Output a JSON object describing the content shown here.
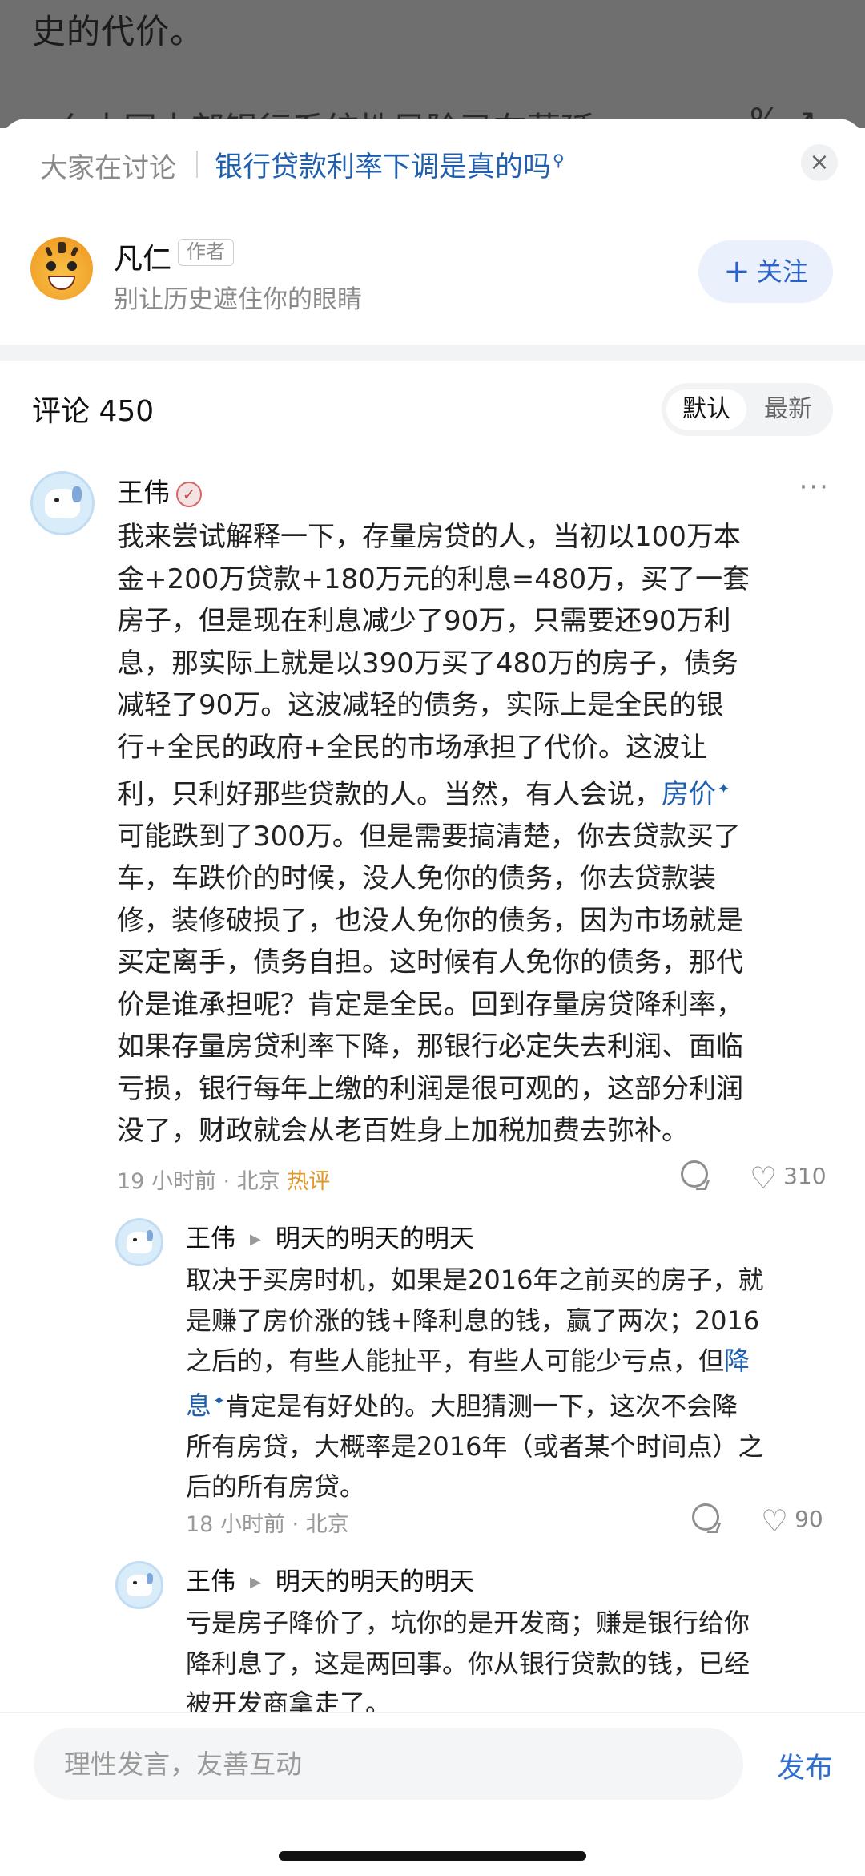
{
  "background": {
    "top_text": "史的代价。",
    "partial_line": "么中国中部银行系统性风险已在蔓延",
    "partial_icons": "%  ↗"
  },
  "discussion": {
    "label": "大家在讨论",
    "topic": "银行贷款利率下调是真的吗",
    "topic_icon": "search-icon",
    "close_glyph": "×"
  },
  "author": {
    "name": "凡仁",
    "tag": "作者",
    "bio": "别让历史遮住你的眼睛",
    "follow_label": "关注",
    "follow_glyph": "+"
  },
  "comments_header": {
    "title": "评论 450",
    "sort_default": "默认",
    "sort_latest": "最新"
  },
  "comment": {
    "name": "王伟",
    "verified_glyph": "✓",
    "more_glyph": "···",
    "lines": [
      "我来尝试解释一下，存量房贷的人，当初以100万本",
      "金+200万贷款+180万元的利息=480万，买了一套",
      "房子，但是现在利息减少了90万，只需要还90万利",
      "息，那实际上就是以390万买了480万的房子，债务",
      "减轻了90万。这波减轻的债务，实际上是全民的银",
      "行+全民的政府+全民的市场承担了代价。这波让",
      "利，只利好那些贷款的人。当然，有人会说，",
      "可能跌到了300万。但是需要搞清楚，你去贷款买了",
      "车，车跌价的时候，没人免你的债务，你去贷款装",
      "修，装修破损了，也没人免你的债务，因为市场就是",
      "买定离手，债务自担。这时候有人免你的债务，那代",
      "价是谁承担呢？肯定是全民。回到存量房贷降利率，",
      "如果存量房贷利率下降，那银行必定失去利润、面临",
      "亏损，银行每年上缴的利润是很可观的，这部分利润",
      "没了，财政就会从老百姓身上加税加费去弥补。"
    ],
    "link_text": "房价",
    "link_sup": "✦",
    "time": "19 小时前 · 北京",
    "hot_badge": "热评",
    "likes": "310"
  },
  "replies": [
    {
      "name": "王伟",
      "reply_to": "明天的明天的明天",
      "lines": [
        "取决于买房时机，如果是2016年之前买的房子，就",
        "是赚了房价涨的钱+降利息的钱，赢了两次；2016",
        "之后的，有些人能扯平，有些人可能少亏点，但",
        "肯定是有好处的。大胆猜测一下，这次不会降",
        "所有房贷，大概率是2016年（或者某个时间点）之",
        "后的所有房贷。"
      ],
      "link_a": "降",
      "link_b": "息",
      "link_sup": "✦",
      "time": "18 小时前 · 北京",
      "likes": "90"
    },
    {
      "name": "王伟",
      "reply_to": "明天的明天的明天",
      "lines": [
        "亏是房子降价了，坑你的是开发商；赚是银行给你",
        "降利息了，这是两回事。你从银行贷款的钱，已经",
        "被开发商拿走了。"
      ]
    }
  ],
  "bottom": {
    "input_placeholder": "理性发言，友善互动",
    "publish_label": "发布"
  }
}
